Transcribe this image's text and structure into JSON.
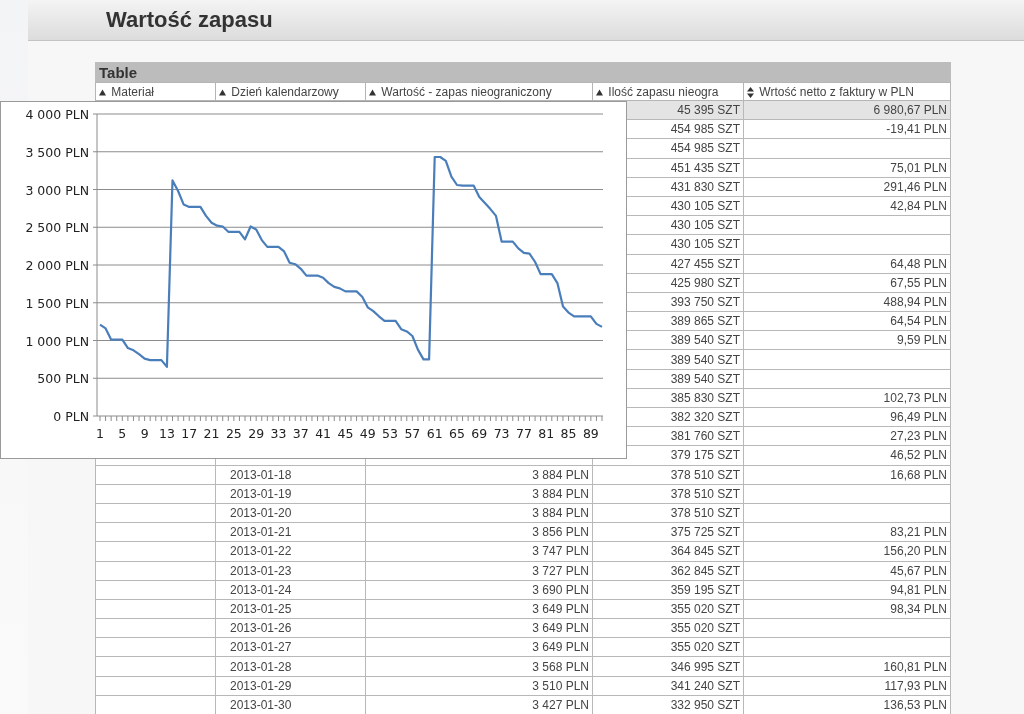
{
  "page": {
    "title": "Wartość zapasu"
  },
  "table": {
    "title": "Table",
    "columns": [
      {
        "label": "Materiał",
        "kind": "up"
      },
      {
        "label": "Dzień kalendarzowy",
        "kind": "up"
      },
      {
        "label": "Wartość - zapas nieograniczony",
        "kind": "up"
      },
      {
        "label": "Ilość zapasu nieogra",
        "kind": "up"
      },
      {
        "label": "Wrtość netto z faktury w PLN",
        "kind": "both"
      }
    ],
    "rows": [
      {
        "qty": "45 395 SZT",
        "net": "6 980,67 PLN",
        "highlighted": true
      },
      {
        "qty": "454 985 SZT",
        "net": "-19,41 PLN",
        "highlighted": false
      },
      {
        "qty": "454 985 SZT",
        "highlighted": false
      },
      {
        "qty": "451 435 SZT",
        "net": "75,01 PLN",
        "highlighted": false
      },
      {
        "qty": "431 830 SZT",
        "net": "291,46 PLN",
        "highlighted": false
      },
      {
        "qty": "430 105 SZT",
        "net": "42,84 PLN",
        "highlighted": false
      },
      {
        "qty": "430 105 SZT",
        "highlighted": false
      },
      {
        "qty": "430 105 SZT",
        "highlighted": false
      },
      {
        "qty": "427 455 SZT",
        "net": "64,48 PLN",
        "highlighted": false
      },
      {
        "qty": "425 980 SZT",
        "net": "67,55 PLN",
        "highlighted": false
      },
      {
        "qty": "393 750 SZT",
        "net": "488,94 PLN",
        "highlighted": false
      },
      {
        "qty": "389 865 SZT",
        "net": "64,54 PLN",
        "highlighted": false
      },
      {
        "qty": "389 540 SZT",
        "net": "9,59 PLN",
        "highlighted": false
      },
      {
        "qty": "389 540 SZT",
        "highlighted": false
      },
      {
        "qty": "389 540 SZT",
        "highlighted": false
      },
      {
        "qty": "385 830 SZT",
        "net": "102,73 PLN",
        "highlighted": false
      },
      {
        "qty": "382 320 SZT",
        "net": "96,49 PLN",
        "highlighted": false
      },
      {
        "qty": "381 760 SZT",
        "net": "27,23 PLN",
        "highlighted": false
      },
      {
        "qty": "379 175 SZT",
        "net": "46,52 PLN",
        "highlighted": false
      },
      {
        "date": "2013-01-18",
        "value": "3 884 PLN",
        "qty": "378 510 SZT",
        "net": "16,68 PLN",
        "highlighted": false
      },
      {
        "date": "2013-01-19",
        "value": "3 884 PLN",
        "qty": "378 510 SZT",
        "highlighted": false
      },
      {
        "date": "2013-01-20",
        "value": "3 884 PLN",
        "qty": "378 510 SZT",
        "highlighted": false
      },
      {
        "date": "2013-01-21",
        "value": "3 856 PLN",
        "qty": "375 725 SZT",
        "net": "83,21 PLN",
        "highlighted": false
      },
      {
        "date": "2013-01-22",
        "value": "3 747 PLN",
        "qty": "364 845 SZT",
        "net": "156,20 PLN",
        "highlighted": false
      },
      {
        "date": "2013-01-23",
        "value": "3 727 PLN",
        "qty": "362 845 SZT",
        "net": "45,67 PLN",
        "highlighted": false
      },
      {
        "date": "2013-01-24",
        "value": "3 690 PLN",
        "qty": "359 195 SZT",
        "net": "94,81 PLN",
        "highlighted": false
      },
      {
        "date": "2013-01-25",
        "value": "3 649 PLN",
        "qty": "355 020 SZT",
        "net": "98,34 PLN",
        "highlighted": false
      },
      {
        "date": "2013-01-26",
        "value": "3 649 PLN",
        "qty": "355 020 SZT",
        "highlighted": false
      },
      {
        "date": "2013-01-27",
        "value": "3 649 PLN",
        "qty": "355 020 SZT",
        "highlighted": false
      },
      {
        "date": "2013-01-28",
        "value": "3 568 PLN",
        "qty": "346 995 SZT",
        "net": "160,81 PLN",
        "highlighted": false
      },
      {
        "date": "2013-01-29",
        "value": "3 510 PLN",
        "qty": "341 240 SZT",
        "net": "117,93 PLN",
        "highlighted": false
      },
      {
        "date": "2013-01-30",
        "value": "3 427 PLN",
        "qty": "332 950 SZT",
        "net": "136,53 PLN",
        "highlighted": false
      }
    ]
  },
  "chart": {
    "chart_data": {
      "type": "line",
      "x": [
        1,
        2,
        3,
        4,
        5,
        6,
        7,
        8,
        9,
        10,
        11,
        12,
        13,
        14,
        15,
        16,
        17,
        18,
        19,
        20,
        21,
        22,
        23,
        24,
        25,
        26,
        27,
        28,
        29,
        30,
        31,
        32,
        33,
        34,
        35,
        36,
        37,
        38,
        39,
        40,
        41,
        42,
        43,
        44,
        45,
        46,
        47,
        48,
        49,
        50,
        51,
        52,
        53,
        54,
        55,
        56,
        57,
        58,
        59,
        60,
        61,
        62,
        63,
        64,
        65,
        66,
        67,
        68,
        69,
        70,
        71,
        72,
        73,
        74,
        75,
        76,
        77,
        78,
        79,
        80,
        81,
        82,
        83,
        84,
        85,
        86,
        87,
        88,
        89,
        90,
        91
      ],
      "grid": true,
      "series": [
        {
          "color": "#4a7ebb",
          "values": [
            1210,
            1160,
            1010,
            1010,
            1010,
            900,
            870,
            820,
            760,
            740,
            740,
            740,
            650,
            3120,
            2980,
            2800,
            2770,
            2770,
            2770,
            2650,
            2560,
            2520,
            2510,
            2440,
            2440,
            2440,
            2340,
            2510,
            2470,
            2330,
            2240,
            2240,
            2240,
            2180,
            2030,
            2010,
            1950,
            1860,
            1860,
            1860,
            1830,
            1760,
            1710,
            1690,
            1650,
            1650,
            1650,
            1580,
            1440,
            1390,
            1320,
            1260,
            1260,
            1260,
            1150,
            1120,
            1060,
            880,
            750,
            750,
            3430,
            3430,
            3380,
            3170,
            3060,
            3050,
            3050,
            3050,
            2900,
            2820,
            2740,
            2650,
            2310,
            2310,
            2310,
            2220,
            2160,
            2150,
            2040,
            1880,
            1880,
            1880,
            1760,
            1450,
            1370,
            1320,
            1320,
            1320,
            1320,
            1220,
            1180
          ]
        }
      ],
      "xlim": [
        1,
        91
      ],
      "ylim": [
        0,
        4000
      ],
      "xticks": [
        1,
        5,
        9,
        13,
        17,
        21,
        25,
        29,
        33,
        37,
        41,
        45,
        49,
        53,
        57,
        61,
        65,
        69,
        73,
        77,
        81,
        85,
        89
      ],
      "yticks": [
        {
          "value": 0,
          "label": "0 PLN"
        },
        {
          "value": 500,
          "label": "500 PLN"
        },
        {
          "value": 1000,
          "label": "1 000 PLN"
        },
        {
          "value": 1500,
          "label": "1 500 PLN"
        },
        {
          "value": 2000,
          "label": "2 000 PLN"
        },
        {
          "value": 2500,
          "label": "2 500 PLN"
        },
        {
          "value": 3000,
          "label": "3 000 PLN"
        },
        {
          "value": 3500,
          "label": "3 500 PLN"
        },
        {
          "value": 4000,
          "label": "4 000 PLN"
        }
      ]
    }
  }
}
